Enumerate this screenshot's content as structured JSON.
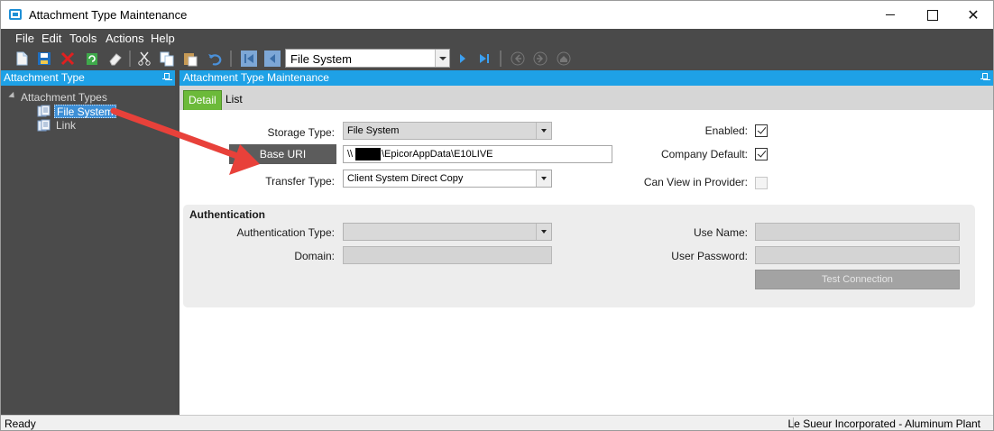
{
  "window": {
    "title": "Attachment Type Maintenance"
  },
  "menu": [
    "File",
    "Edit",
    "Tools",
    "Actions",
    "Help"
  ],
  "toolbar": {
    "navigator_value": "File System"
  },
  "left_pane": {
    "header": "Attachment Type",
    "tree": {
      "root": "Attachment Types",
      "children": [
        {
          "label": "File System",
          "selected": true
        },
        {
          "label": "Link",
          "selected": false
        }
      ]
    }
  },
  "right_pane": {
    "header": "Attachment Type Maintenance",
    "tabs": [
      "Detail",
      "List"
    ],
    "detail": {
      "storage_type": {
        "label": "Storage Type:",
        "value": "File System"
      },
      "base_uri": {
        "button": "Base URI",
        "prefix": "\\\\",
        "value": "\\EpicorAppData\\E10LIVE"
      },
      "transfer_type": {
        "label": "Transfer Type:",
        "value": "Client System Direct Copy"
      },
      "enabled": {
        "label": "Enabled:",
        "checked": true
      },
      "company_default": {
        "label": "Company Default:",
        "checked": true
      },
      "can_view_in_provider": {
        "label": "Can View in Provider:",
        "checked": false
      },
      "authentication": {
        "title": "Authentication",
        "auth_type": {
          "label": "Authentication Type:",
          "value": ""
        },
        "domain": {
          "label": "Domain:",
          "value": ""
        },
        "use_name": {
          "label": "Use Name:",
          "value": ""
        },
        "user_password": {
          "label": "User Password:",
          "value": ""
        },
        "test_button": "Test Connection"
      }
    }
  },
  "status": {
    "left": "Ready",
    "right": "Le Sueur Incorporated - Aluminum Plant"
  },
  "colors": {
    "accent": "#1ea1e6",
    "tab_active": "#6cba3a",
    "annotation": "#e8413a"
  }
}
